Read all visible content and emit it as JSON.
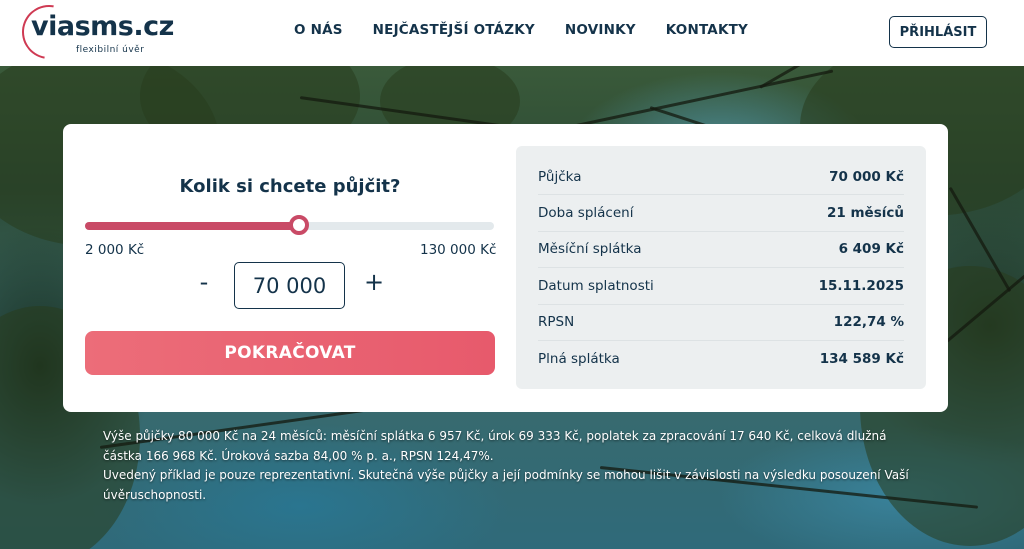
{
  "header": {
    "logo_text": "viasms.cz",
    "logo_subtitle": "flexibilní úvěr",
    "nav": [
      "O NÁS",
      "NEJČASTĚJŠÍ OTÁZKY",
      "NOVINKY",
      "KONTAKTY"
    ],
    "login_label": "PŘIHLÁSIT"
  },
  "calculator": {
    "title": "Kolik si chcete půjčit?",
    "min_label": "2 000 Kč",
    "max_label": "130 000 Kč",
    "amount": "70 000",
    "slider_fraction": 0.523,
    "minus_label": "-",
    "plus_label": "+",
    "continue_label": "POKRAČOVAT"
  },
  "summary": {
    "rows": [
      {
        "label": "Půjčka",
        "value": "70 000 Kč"
      },
      {
        "label": "Doba splácení",
        "value": "21 měsíců"
      },
      {
        "label": "Měsíční splátka",
        "value": "6 409 Kč"
      },
      {
        "label": "Datum splatnosti",
        "value": "15.11.2025"
      },
      {
        "label": "RPSN",
        "value": "122,74 %"
      },
      {
        "label": "Plná splátka",
        "value": "134 589 Kč"
      }
    ]
  },
  "disclaimer": {
    "line1": "Výše půjčky 80 000 Kč na 24 měsíců: měsíční splátka 6 957 Kč, úrok 69 333 Kč, poplatek za zpracování 17 640 Kč, celková dlužná částka 166 968 Kč. Úroková sazba 84,00 % p. a., RPSN  124,47%.",
    "line2": "Uvedený příklad je pouze reprezentativní. Skutečná výše půjčky a její podmínky se mohou lišit v závislosti na výsledku posouzení Vaší úvěruschopnosti."
  },
  "colors": {
    "brand_navy": "#14334a",
    "accent_pink": "#e75a6c",
    "slider": "#c94a66"
  }
}
